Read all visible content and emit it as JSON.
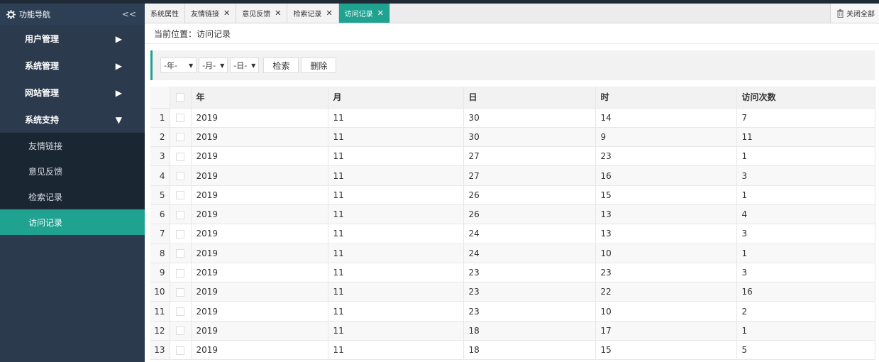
{
  "sidebar": {
    "title": "功能导航",
    "collapse_symbol": "<<",
    "menus": [
      {
        "label": "用户管理",
        "arrow": "▶"
      },
      {
        "label": "系统管理",
        "arrow": "▶"
      },
      {
        "label": "网站管理",
        "arrow": "▶"
      },
      {
        "label": "系统支持",
        "arrow": "▼"
      }
    ],
    "subitems": [
      "友情链接",
      "意见反馈",
      "检索记录",
      "访问记录"
    ],
    "active_subitem": "访问记录"
  },
  "tabs": [
    {
      "label": "系统属性",
      "close": ""
    },
    {
      "label": "友情链接",
      "close": "✕"
    },
    {
      "label": "意见反馈",
      "close": "✕"
    },
    {
      "label": "检索记录",
      "close": "✕"
    },
    {
      "label": "访问记录",
      "close": "✕"
    }
  ],
  "close_all_label": "关闭全部",
  "breadcrumb": "当前位置：访问记录",
  "filter": {
    "year": "-年-",
    "month": "-月-",
    "day": "-日-",
    "caret": "▼",
    "search_label": "检索",
    "delete_label": "删除"
  },
  "table": {
    "headers": [
      "年",
      "月",
      "日",
      "时",
      "访问次数"
    ],
    "rows": [
      {
        "no": "1",
        "year": "2019",
        "month": "11",
        "day": "30",
        "hour": "14",
        "visits": "7"
      },
      {
        "no": "2",
        "year": "2019",
        "month": "11",
        "day": "30",
        "hour": "9",
        "visits": "11"
      },
      {
        "no": "3",
        "year": "2019",
        "month": "11",
        "day": "27",
        "hour": "23",
        "visits": "1"
      },
      {
        "no": "4",
        "year": "2019",
        "month": "11",
        "day": "27",
        "hour": "16",
        "visits": "3"
      },
      {
        "no": "5",
        "year": "2019",
        "month": "11",
        "day": "26",
        "hour": "15",
        "visits": "1"
      },
      {
        "no": "6",
        "year": "2019",
        "month": "11",
        "day": "26",
        "hour": "13",
        "visits": "4"
      },
      {
        "no": "7",
        "year": "2019",
        "month": "11",
        "day": "24",
        "hour": "13",
        "visits": "3"
      },
      {
        "no": "8",
        "year": "2019",
        "month": "11",
        "day": "24",
        "hour": "10",
        "visits": "1"
      },
      {
        "no": "9",
        "year": "2019",
        "month": "11",
        "day": "23",
        "hour": "23",
        "visits": "3"
      },
      {
        "no": "10",
        "year": "2019",
        "month": "11",
        "day": "23",
        "hour": "22",
        "visits": "16"
      },
      {
        "no": "11",
        "year": "2019",
        "month": "11",
        "day": "23",
        "hour": "10",
        "visits": "2"
      },
      {
        "no": "12",
        "year": "2019",
        "month": "11",
        "day": "18",
        "hour": "17",
        "visits": "1"
      },
      {
        "no": "13",
        "year": "2019",
        "month": "11",
        "day": "18",
        "hour": "15",
        "visits": "5"
      }
    ]
  },
  "colors": {
    "accent": "#1fa290",
    "sidebar_bg": "#2b3a4d",
    "submenu_bg": "#1b2633"
  },
  "icons": {
    "sidebar_title": "gear-icon",
    "close_all": "trash-icon"
  }
}
